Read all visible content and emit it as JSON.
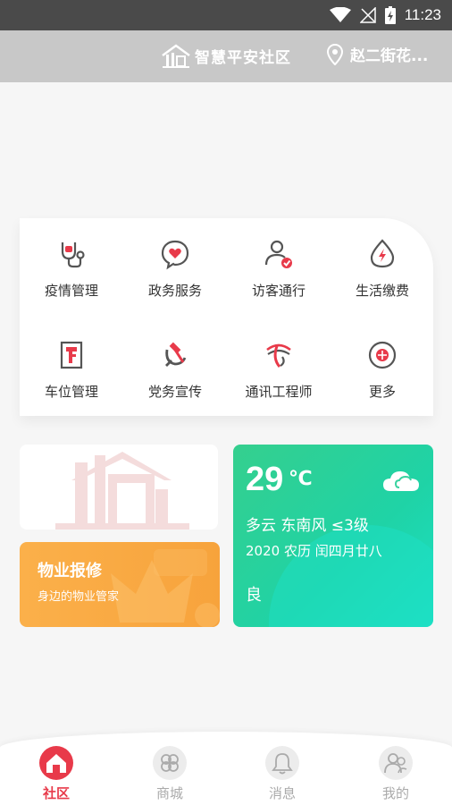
{
  "status_bar": {
    "time": "11:23"
  },
  "header": {
    "brand": "智慧平安社区",
    "location": "赵二街花..."
  },
  "services": [
    {
      "label": "疫情管理",
      "icon": "stethoscope-icon"
    },
    {
      "label": "政务服务",
      "icon": "heart-chat-icon"
    },
    {
      "label": "访客通行",
      "icon": "visitor-icon"
    },
    {
      "label": "生活缴费",
      "icon": "water-drop-bolt-icon"
    },
    {
      "label": "车位管理",
      "icon": "parking-icon"
    },
    {
      "label": "党务宣传",
      "icon": "hammer-sickle-icon"
    },
    {
      "label": "通讯工程师",
      "icon": "telecom-icon"
    },
    {
      "label": "更多",
      "icon": "more-icon"
    }
  ],
  "repair": {
    "title": "物业报修",
    "subtitle": "身边的物业管家"
  },
  "weather": {
    "temperature": "29",
    "unit": "℃",
    "condition": "多云 东南风 ≤3级",
    "date": "2020 农历 闰四月廿八",
    "air_quality": "良"
  },
  "nav": [
    {
      "label": "社区",
      "icon": "home-icon",
      "active": true
    },
    {
      "label": "商城",
      "icon": "shop-icon",
      "active": false
    },
    {
      "label": "消息",
      "icon": "bell-icon",
      "active": false
    },
    {
      "label": "我的",
      "icon": "profile-icon",
      "active": false
    }
  ],
  "colors": {
    "accent": "#e83a4a",
    "weather_green": "#2bd39a",
    "repair_orange": "#f9a742"
  }
}
